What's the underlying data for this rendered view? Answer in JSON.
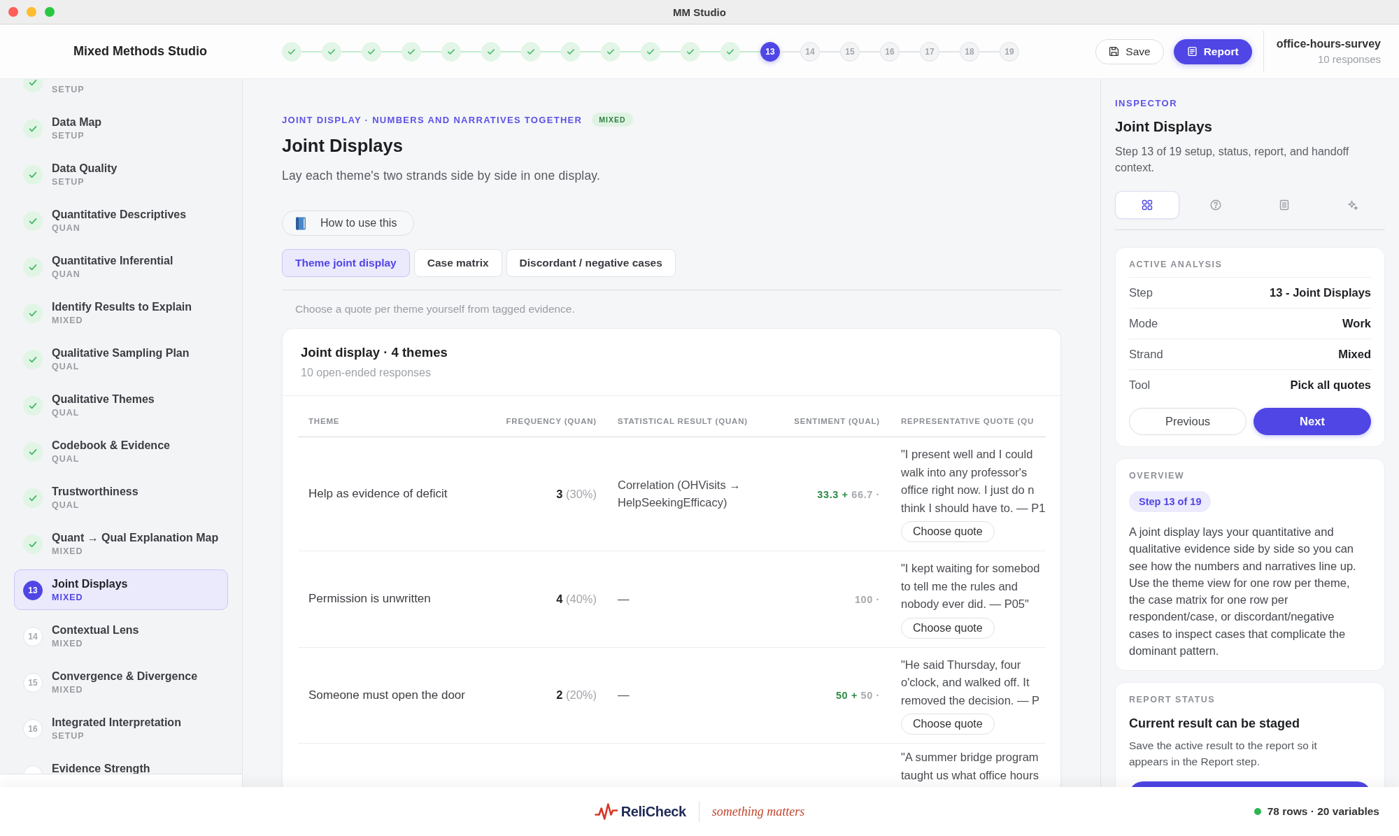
{
  "window": {
    "title": "MM Studio"
  },
  "header": {
    "brand": "Mixed Methods Studio",
    "steps": [
      {
        "kind": "done",
        "selected": false
      },
      {
        "kind": "done",
        "selected": false
      },
      {
        "kind": "done",
        "selected": false
      },
      {
        "kind": "done",
        "selected": false
      },
      {
        "kind": "done",
        "selected": false
      },
      {
        "kind": "done",
        "selected": false
      },
      {
        "kind": "done",
        "selected": false
      },
      {
        "kind": "done",
        "selected": false
      },
      {
        "kind": "done",
        "selected": false
      },
      {
        "kind": "done",
        "selected": false
      },
      {
        "kind": "done",
        "selected": false
      },
      {
        "kind": "done",
        "selected": false
      },
      {
        "kind": "number",
        "label": "13",
        "selected": true
      },
      {
        "kind": "number",
        "label": "14",
        "selected": false
      },
      {
        "kind": "number",
        "label": "15",
        "selected": false
      },
      {
        "kind": "number",
        "label": "16",
        "selected": false
      },
      {
        "kind": "number",
        "label": "17",
        "selected": false
      },
      {
        "kind": "number",
        "label": "18",
        "selected": false
      },
      {
        "kind": "number",
        "label": "19",
        "selected": false
      }
    ],
    "save": "Save",
    "report": "Report",
    "dataset": "office-hours-survey",
    "responses": "10 responses"
  },
  "sidebar": {
    "items": [
      {
        "strand": "SETUP",
        "kind": "done",
        "selected": false
      },
      {
        "title": "Data Map",
        "strand": "SETUP",
        "kind": "done",
        "selected": false
      },
      {
        "title": "Data Quality",
        "strand": "SETUP",
        "kind": "done",
        "selected": false
      },
      {
        "title": "Quantitative Descriptives",
        "strand": "QUAN",
        "kind": "done",
        "selected": false
      },
      {
        "title": "Quantitative Inferential",
        "strand": "QUAN",
        "kind": "done",
        "selected": false
      },
      {
        "title": "Identify Results to Explain",
        "strand": "MIXED",
        "kind": "done",
        "selected": false
      },
      {
        "title": "Qualitative Sampling Plan",
        "strand": "QUAL",
        "kind": "done",
        "selected": false
      },
      {
        "title": "Qualitative Themes",
        "strand": "QUAL",
        "kind": "done",
        "selected": false
      },
      {
        "title": "Codebook & Evidence",
        "strand": "QUAL",
        "kind": "done",
        "selected": false
      },
      {
        "title": "Trustworthiness",
        "strand": "QUAL",
        "kind": "done",
        "selected": false
      },
      {
        "title": "Quant → Qual Explanation Map",
        "strand": "MIXED",
        "kind": "done",
        "selected": false
      },
      {
        "title": "Joint Displays",
        "strand": "MIXED",
        "kind": "number",
        "number": "13",
        "selected": true
      },
      {
        "title": "Contextual Lens",
        "strand": "MIXED",
        "kind": "number",
        "number": "14",
        "selected": false
      },
      {
        "title": "Convergence & Divergence",
        "strand": "MIXED",
        "kind": "number",
        "number": "15",
        "selected": false
      },
      {
        "title": "Integrated Interpretation",
        "strand": "SETUP",
        "kind": "number",
        "number": "16",
        "selected": false
      },
      {
        "title": "Evidence Strength",
        "kind": "number",
        "selected": false
      }
    ]
  },
  "main": {
    "eyebrow": "JOINT DISPLAY · NUMBERS AND NARRATIVES TOGETHER",
    "badge": "MIXED",
    "title": "Joint Displays",
    "subtitle": "Lay each theme's two strands side by side in one display.",
    "help_button": "How to use this",
    "tabs": [
      {
        "label": "Theme joint display",
        "selected": true
      },
      {
        "label": "Case matrix",
        "selected": false
      },
      {
        "label": "Discordant / negative cases",
        "selected": false
      }
    ],
    "hint": "Choose a quote per theme yourself from tagged evidence.",
    "card": {
      "title": "Joint display · 4 themes",
      "subtitle": "10 open-ended responses",
      "table": {
        "columns": [
          "THEME",
          "FREQUENCY (QUAN)",
          "STATISTICAL RESULT (QUAN)",
          "SENTIMENT (QUAL)",
          "REPRESENTATIVE QUOTE (QU"
        ],
        "rows": [
          {
            "theme": "Help as evidence of deficit",
            "count": "3",
            "share": "(30%)",
            "stat": "Correlation (OHVisits → HelpSeekingEfficacy)",
            "sentiment": [
              {
                "text": "33.3 +",
                "kind": "positive"
              },
              {
                "text": "66.7 ·",
                "kind": "neutral"
              }
            ],
            "quote_lines": [
              "\"I present well and I could",
              "walk into any professor's",
              "office right now. I just do n",
              "think I should have to. — P1"
            ],
            "action": "Choose quote"
          },
          {
            "theme": "Permission is unwritten",
            "count": "4",
            "share": "(40%)",
            "stat": "—",
            "sentiment": [
              {
                "text": "100 ·",
                "kind": "neutral"
              }
            ],
            "quote_lines": [
              "\"I kept waiting for somebod",
              "to tell me the rules and",
              "nobody ever did. — P05\""
            ],
            "action": "Choose quote"
          },
          {
            "theme": "Someone must open the door",
            "count": "2",
            "share": "(20%)",
            "stat": "—",
            "sentiment": [
              {
                "text": "50 +",
                "kind": "positive"
              },
              {
                "text": "50 ·",
                "kind": "neutral"
              }
            ],
            "quote_lines": [
              "\"He said Thursday, four",
              "o'clock, and walked off. It",
              "removed the decision. — P"
            ],
            "action": "Choose quote"
          },
          {
            "quote_lines": [
              "\"A summer bridge program",
              "taught us what office hours"
            ]
          }
        ]
      }
    }
  },
  "inspector": {
    "eyebrow": "INSPECTOR",
    "title": "Joint Displays",
    "description": "Step 13 of 19 setup, status, report, and handoff context.",
    "tabs": [
      {
        "selected": true
      },
      {
        "selected": false
      },
      {
        "selected": false
      },
      {
        "selected": false
      }
    ],
    "analysis": {
      "label": "ACTIVE ANALYSIS",
      "rows": [
        {
          "key": "Step",
          "value": "13 - Joint Displays"
        },
        {
          "key": "Mode",
          "value": "Work"
        },
        {
          "key": "Strand",
          "value": "Mixed"
        },
        {
          "key": "Tool",
          "value": "Pick all quotes"
        }
      ],
      "previous": "Previous",
      "next": "Next"
    },
    "overview": {
      "label": "OVERVIEW",
      "pill": "Step 13 of 19",
      "text": "A joint display lays your quantitative and qualitative evidence side by side so you can see how the numbers and narratives line up. Use the theme view for one row per theme, the case matrix for one row per respondent/case, or discordant/negative cases to inspect cases that complicate the dominant pattern."
    },
    "report_status": {
      "label": "REPORT STATUS",
      "title": "Current result can be staged",
      "text": "Save the active result to the report so it appears in the Report step."
    }
  },
  "footer": {
    "brand": "ReliCheck",
    "tagline": "something matters",
    "status": "78 rows · 20 variables"
  }
}
